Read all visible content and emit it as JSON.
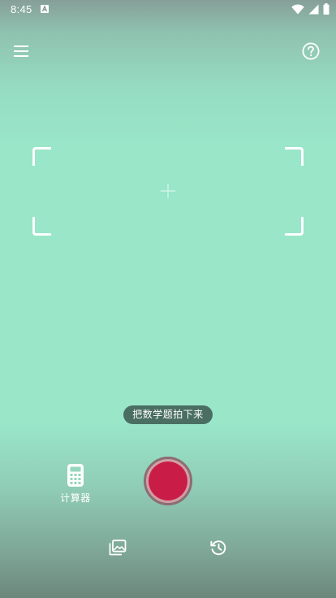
{
  "status_bar": {
    "time": "8:45"
  },
  "header": {
    "menu_icon": "hamburger-menu-icon",
    "help_icon": "help-circle-icon"
  },
  "camera": {
    "hint": "把数学题拍下来"
  },
  "bottom": {
    "calculator_label": "计算器",
    "gallery_icon": "gallery-icon",
    "history_icon": "history-icon"
  },
  "colors": {
    "background": "#99e6c9",
    "shutter": "#c91d47",
    "hint_pill": "#4a6f62"
  }
}
